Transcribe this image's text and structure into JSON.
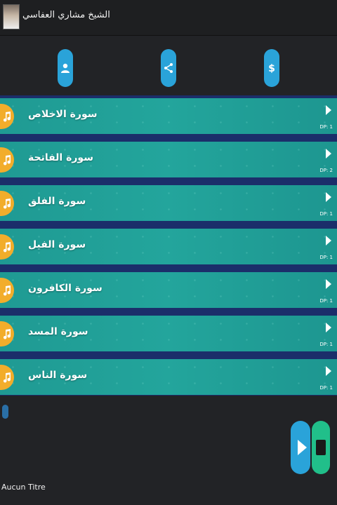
{
  "header": {
    "title": "الشيخ مشاري العفاسي",
    "icon": "reciter-photo"
  },
  "actions": [
    {
      "icon": "person-icon",
      "color": "#2aa3d9"
    },
    {
      "icon": "share-icon",
      "color": "#2aa3d9"
    },
    {
      "icon": "dollar-icon",
      "color": "#2aa3d9"
    }
  ],
  "tracks": [
    {
      "title": "سورة الاخلاص",
      "count": "DP: 1"
    },
    {
      "title": "سورة الفاتحة",
      "count": "DP: 2"
    },
    {
      "title": "سورة الفلق",
      "count": "DP: 1"
    },
    {
      "title": "سورة الفيل",
      "count": "DP: 1"
    },
    {
      "title": "سورة الكافرون",
      "count": "DP: 1"
    },
    {
      "title": "سورة المسد",
      "count": "DP: 1"
    },
    {
      "title": "سورة الناس",
      "count": "DP: 1"
    }
  ],
  "player": {
    "now_playing": "Aucun Titre",
    "play_color": "#2aa3d9",
    "stop_color": "#21bf8a"
  },
  "colors": {
    "row": "#23a59c",
    "separator": "#1b2e6a",
    "note_badge": "#f2ad2b",
    "background": "#222326"
  }
}
